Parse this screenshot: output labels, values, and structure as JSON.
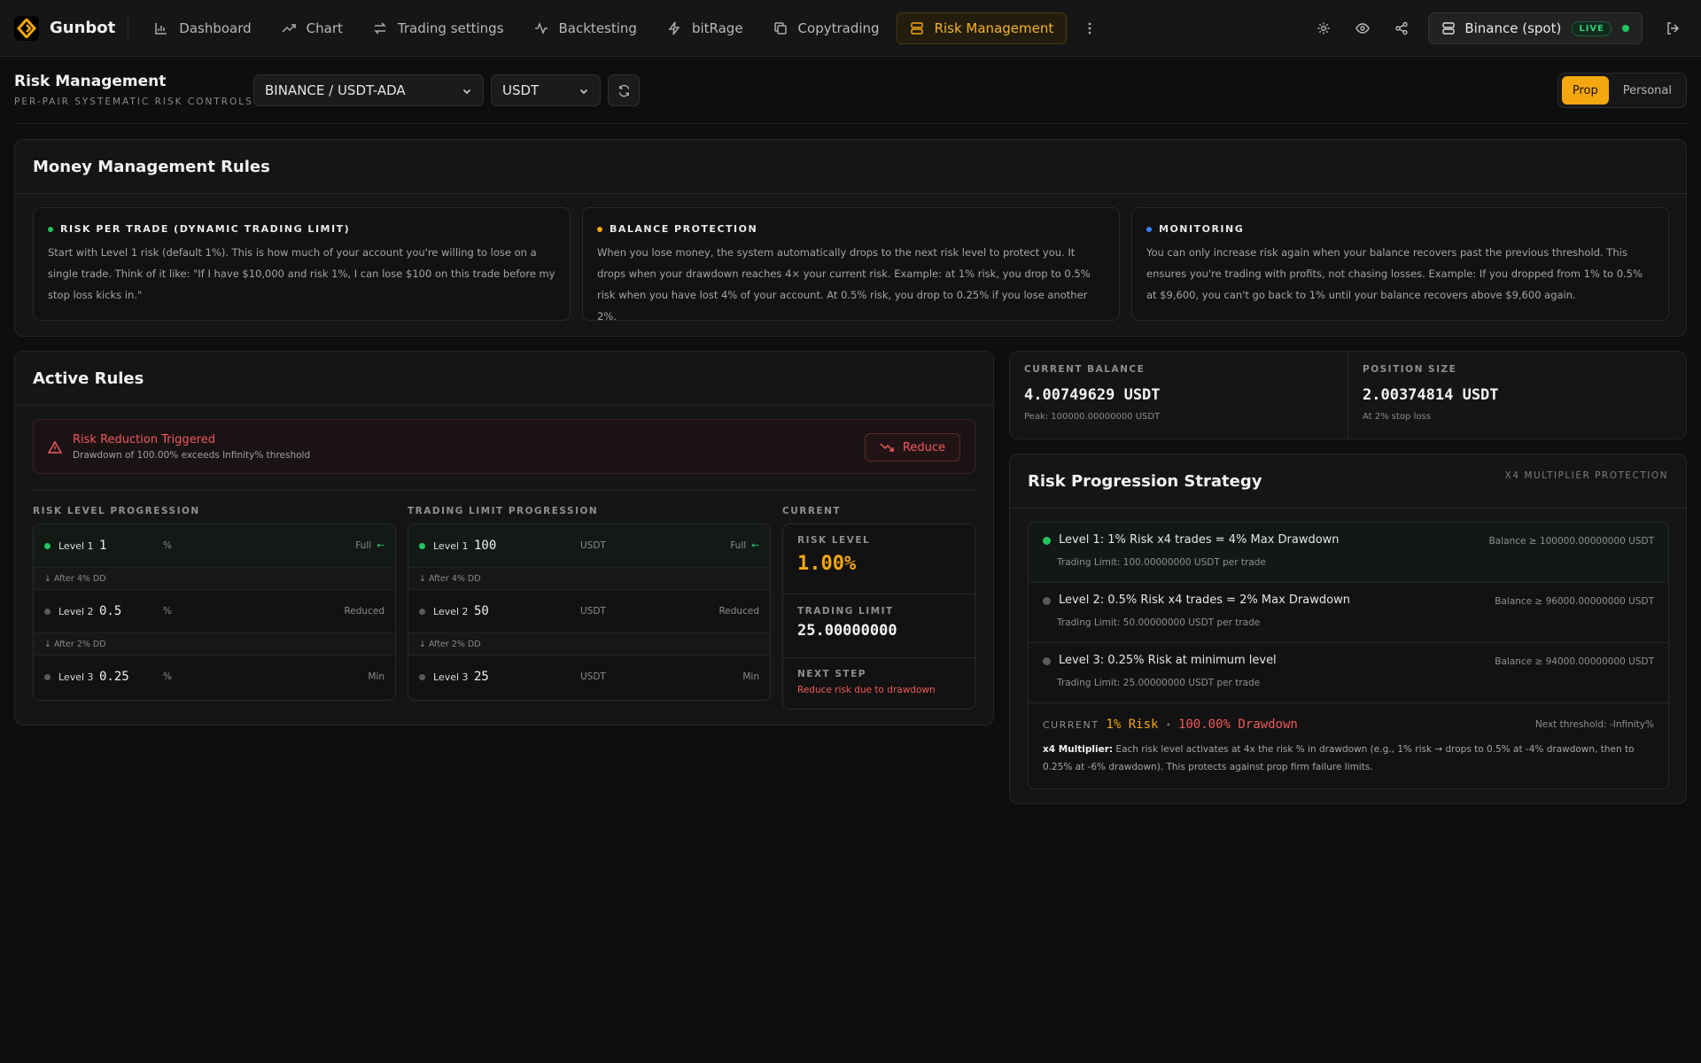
{
  "app": {
    "name": "Gunbot",
    "nav": [
      {
        "label": "Dashboard",
        "icon": "bar-chart-icon"
      },
      {
        "label": "Chart",
        "icon": "trending-up-icon"
      },
      {
        "label": "Trading settings",
        "icon": "arrows-exchange-icon"
      },
      {
        "label": "Backtesting",
        "icon": "activity-icon"
      },
      {
        "label": "bitRage",
        "icon": "lightning-icon"
      },
      {
        "label": "Copytrading",
        "icon": "copy-icon"
      },
      {
        "label": "Risk Management",
        "icon": "server-icon",
        "active": true
      }
    ],
    "exchange": {
      "label": "Binance (spot)",
      "badge": "LIVE"
    }
  },
  "header": {
    "title": "Risk Management",
    "subtitle": "PER-PAIR SYSTEMATIC RISK CONTROLS",
    "pair": "BINANCE / USDT-ADA",
    "currency": "USDT",
    "toggle": [
      "Prop",
      "Personal"
    ],
    "toggle_selected": "Prop"
  },
  "money_management": {
    "title": "Money Management Rules",
    "cards": [
      {
        "title": "RISK PER TRADE (DYNAMIC TRADING LIMIT)",
        "color": "#22c55e",
        "body": "Start with Level 1 risk (default 1%). This is how much of your account you're willing to lose on a single trade. Think of it like: \"If I have $10,000 and risk 1%, I can lose $100 on this trade before my stop loss kicks in.\""
      },
      {
        "title": "BALANCE PROTECTION",
        "color": "#f5a70f",
        "body": "When you lose money, the system automatically drops to the next risk level to protect you. It drops when your drawdown reaches 4× your current risk. Example: at 1% risk, you drop to 0.5% risk when you have lost 4% of your account. At 0.5% risk, you drop to 0.25% if you lose another 2%."
      },
      {
        "title": "MONITORING",
        "color": "#3b82f6",
        "body": "You can only increase risk again when your balance recovers past the previous threshold. This ensures you're trading with profits, not chasing losses. Example: If you dropped from 1% to 0.5% at $9,600, you can't go back to 1% until your balance recovers above $9,600 again."
      }
    ]
  },
  "active_rules": {
    "title": "Active Rules",
    "alert": {
      "title": "Risk Reduction Triggered",
      "subtitle": "Drawdown of 100.00% exceeds Infinity% threshold",
      "button": "Reduce"
    },
    "risk_label": "RISK LEVEL PROGRESSION",
    "limit_label": "TRADING LIMIT PROGRESSION",
    "current_label": "CURRENT",
    "risk_levels": [
      {
        "name": "Level 1",
        "value": "1",
        "unit": "%",
        "tag": "Full",
        "arrow": "←"
      },
      {
        "name": "Level 2",
        "value": "0.5",
        "unit": "%",
        "tag": "Reduced"
      },
      {
        "name": "Level 3",
        "value": "0.25",
        "unit": "%",
        "tag": "Min"
      }
    ],
    "limit_levels": [
      {
        "name": "Level 1",
        "value": "100",
        "unit": "USDT",
        "tag": "Full",
        "arrow": "←"
      },
      {
        "name": "Level 2",
        "value": "50",
        "unit": "USDT",
        "tag": "Reduced"
      },
      {
        "name": "Level 3",
        "value": "25",
        "unit": "USDT",
        "tag": "Min"
      }
    ],
    "after": [
      "↓ After 4% DD",
      "↓ After 2% DD"
    ],
    "current": {
      "risk_label": "RISK LEVEL",
      "risk_value": "1.00%",
      "limit_label": "TRADING LIMIT",
      "limit_value": "25.00000000",
      "next_label": "NEXT STEP",
      "next_value": "Reduce risk due to drawdown"
    }
  },
  "stats": {
    "balance": {
      "label": "CURRENT BALANCE",
      "value": "4.00749629 USDT",
      "sub": "Peak: 100000.00000000 USDT"
    },
    "position": {
      "label": "POSITION SIZE",
      "value": "2.00374814 USDT",
      "sub": "At 2% stop loss"
    }
  },
  "risk_progression": {
    "title": "Risk Progression Strategy",
    "note": "X4 MULTIPLIER PROTECTION",
    "levels": [
      {
        "title": "Level 1: 1% Risk x4 trades = 4% Max Drawdown",
        "sub": "Trading Limit: 100.00000000 USDT per trade",
        "balance": "Balance ≥ 100000.00000000 USDT"
      },
      {
        "title": "Level 2: 0.5% Risk x4 trades = 2% Max Drawdown",
        "sub": "Trading Limit: 50.00000000 USDT per trade",
        "balance": "Balance ≥ 96000.00000000 USDT"
      },
      {
        "title": "Level 3: 0.25% Risk at minimum level",
        "sub": "Trading Limit: 25.00000000 USDT per trade",
        "balance": "Balance ≥ 94000.00000000 USDT"
      }
    ],
    "current_label": "CURRENT",
    "current_risk": "1% Risk",
    "current_sep": "•",
    "current_drawdown": "100.00% Drawdown",
    "next_threshold": "Next threshold: -Infinity%",
    "multiplier_label": "x4 Multiplier:",
    "multiplier_text": " Each risk level activates at 4x the risk % in drawdown (e.g., 1% risk → drops to 0.5% at -4% drawdown, then to 0.25% at -6% drawdown). This protects against prop firm failure limits."
  },
  "colors": {
    "accent": "#f5a70f",
    "success": "#22c55e",
    "danger": "#f05a5a",
    "info": "#3b82f6",
    "inactive": "#5a5a5a"
  }
}
